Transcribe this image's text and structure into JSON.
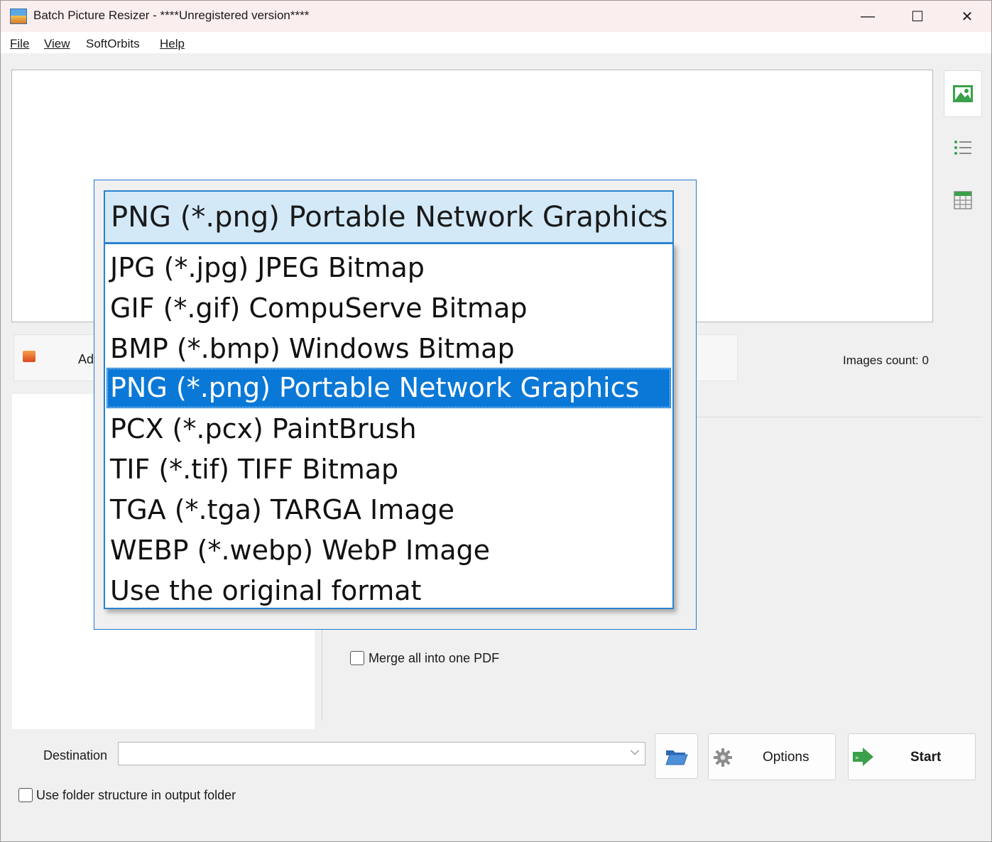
{
  "window": {
    "title": "Batch Picture Resizer - ****Unregistered version****",
    "minimize_glyph": "—",
    "maximize_glyph": "☐",
    "close_glyph": "✕"
  },
  "menu": {
    "file": "File",
    "view": "View",
    "softorbits": "SoftOrbits",
    "help": "Help"
  },
  "side_toolbar": {
    "icons": [
      "image-view-icon",
      "list-view-icon",
      "table-view-icon"
    ]
  },
  "main": {
    "add_button_label": "Ad",
    "images_count": "Images count: 0",
    "merge_pdf_label": "Merge all into one PDF",
    "merge_pdf_checked": false
  },
  "bottom": {
    "destination_label": "Destination",
    "destination_value": "",
    "use_folder_structure_label": "Use folder structure in output folder",
    "use_folder_structure_checked": false,
    "options_label": "Options",
    "start_label": "Start"
  },
  "format_dialog": {
    "selected_value": "PNG (*.png) Portable Network Graphics",
    "options": [
      "JPG (*.jpg) JPEG Bitmap",
      "GIF (*.gif) CompuServe Bitmap",
      "BMP (*.bmp) Windows Bitmap",
      "PNG (*.png) Portable Network Graphics",
      "PCX (*.pcx) PaintBrush",
      "TIF (*.tif) TIFF Bitmap",
      "TGA (*.tga) TARGA Image",
      "WEBP (*.webp) WebP Image",
      "Use the original format"
    ],
    "highlighted_index": 3
  },
  "colors": {
    "accent": "#0a78d7",
    "combo_bg": "#d3e9f8",
    "titlebar_bg": "#fbeeee",
    "green_icon": "#3aa04a"
  }
}
